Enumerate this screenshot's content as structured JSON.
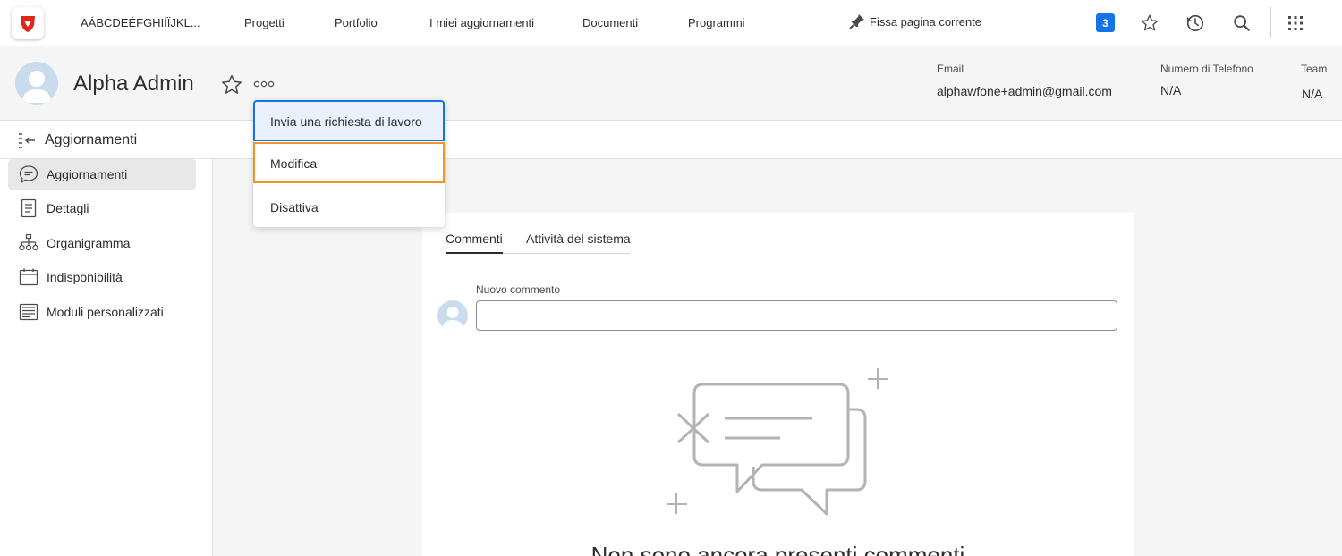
{
  "topbar": {
    "app_name": "AÁBCDEÉFGHIÍÏJKL...",
    "nav": [
      "Progetti",
      "Portfolio",
      "I miei aggiornamenti",
      "Documenti",
      "Programmi"
    ],
    "pin_label": "Fissa pagina corrente",
    "badge_count": "3",
    "icons": [
      "star-icon",
      "history-icon",
      "search-icon",
      "apps-grid-icon"
    ]
  },
  "header": {
    "user_name": "Alpha Admin",
    "email_label": "Email",
    "email_value": "alphawfone+admin@gmail.com",
    "phone_label": "Numero di Telefono",
    "phone_value": "N/A",
    "team_label": "Team",
    "team_value": "N/A"
  },
  "section": {
    "title": "Aggiornamenti"
  },
  "sidebar": {
    "items": [
      {
        "label": "Aggiornamenti",
        "icon": "comment-icon",
        "active": true
      },
      {
        "label": "Dettagli",
        "icon": "document-icon",
        "active": false
      },
      {
        "label": "Organigramma",
        "icon": "org-chart-icon",
        "active": false
      },
      {
        "label": "Indisponibilità",
        "icon": "calendar-icon",
        "active": false
      },
      {
        "label": "Moduli personalizzati",
        "icon": "forms-icon",
        "active": false
      }
    ]
  },
  "dropdown": {
    "items": [
      "Invia una richiesta di lavoro",
      "Modifica",
      "Disattiva"
    ]
  },
  "main": {
    "tabs": [
      "Commenti",
      "Attività del sistema"
    ],
    "active_tab": "Commenti",
    "comment_label": "Nuovo commento",
    "comment_value": "",
    "empty_message": "Non sono ancora presenti commenti"
  },
  "colors": {
    "accent": "#1473e6",
    "highlight": "#f29423",
    "brand": "#e1251b"
  }
}
